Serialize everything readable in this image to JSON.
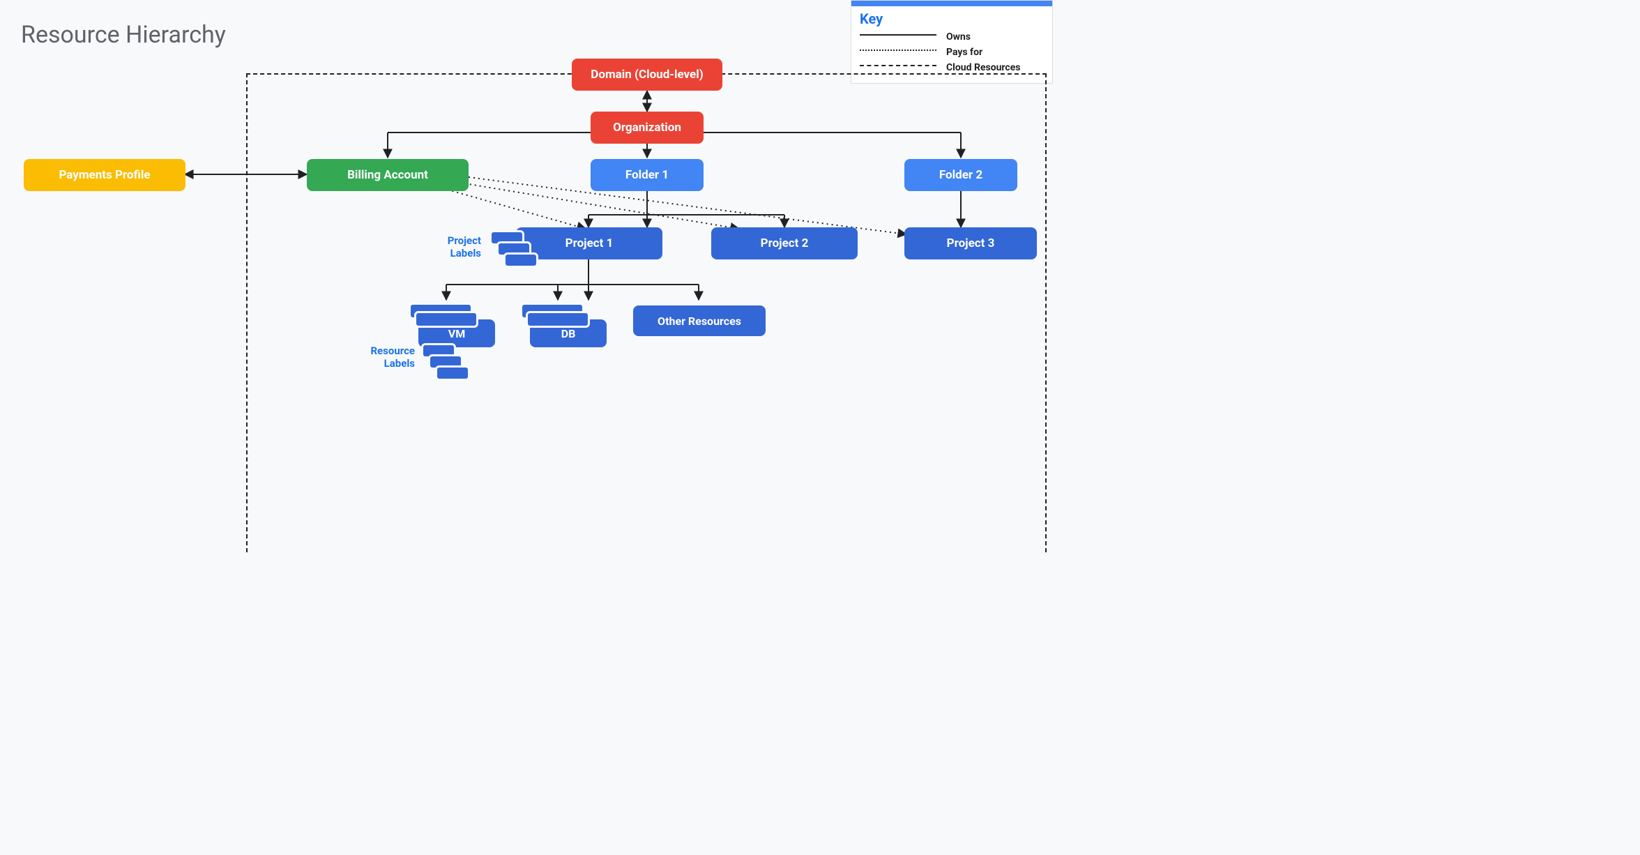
{
  "title": "Resource Hierarchy",
  "legend": {
    "heading": "Key",
    "items": [
      {
        "style": "solid",
        "label": "Owns"
      },
      {
        "style": "dotted",
        "label": "Pays for"
      },
      {
        "style": "dashed",
        "label": "Cloud Resources"
      }
    ]
  },
  "nodes": {
    "domain": "Domain (Cloud-level)",
    "organization": "Organization",
    "payments_profile": "Payments Profile",
    "billing_account": "Billing Account",
    "folder1": "Folder 1",
    "folder2": "Folder 2",
    "project1": "Project 1",
    "project2": "Project 2",
    "project3": "Project 3",
    "vm": "VM",
    "db": "DB",
    "other_resources": "Other Resources"
  },
  "labels": {
    "project_labels": "Project\nLabels",
    "resource_labels": "Resource\nLabels"
  }
}
